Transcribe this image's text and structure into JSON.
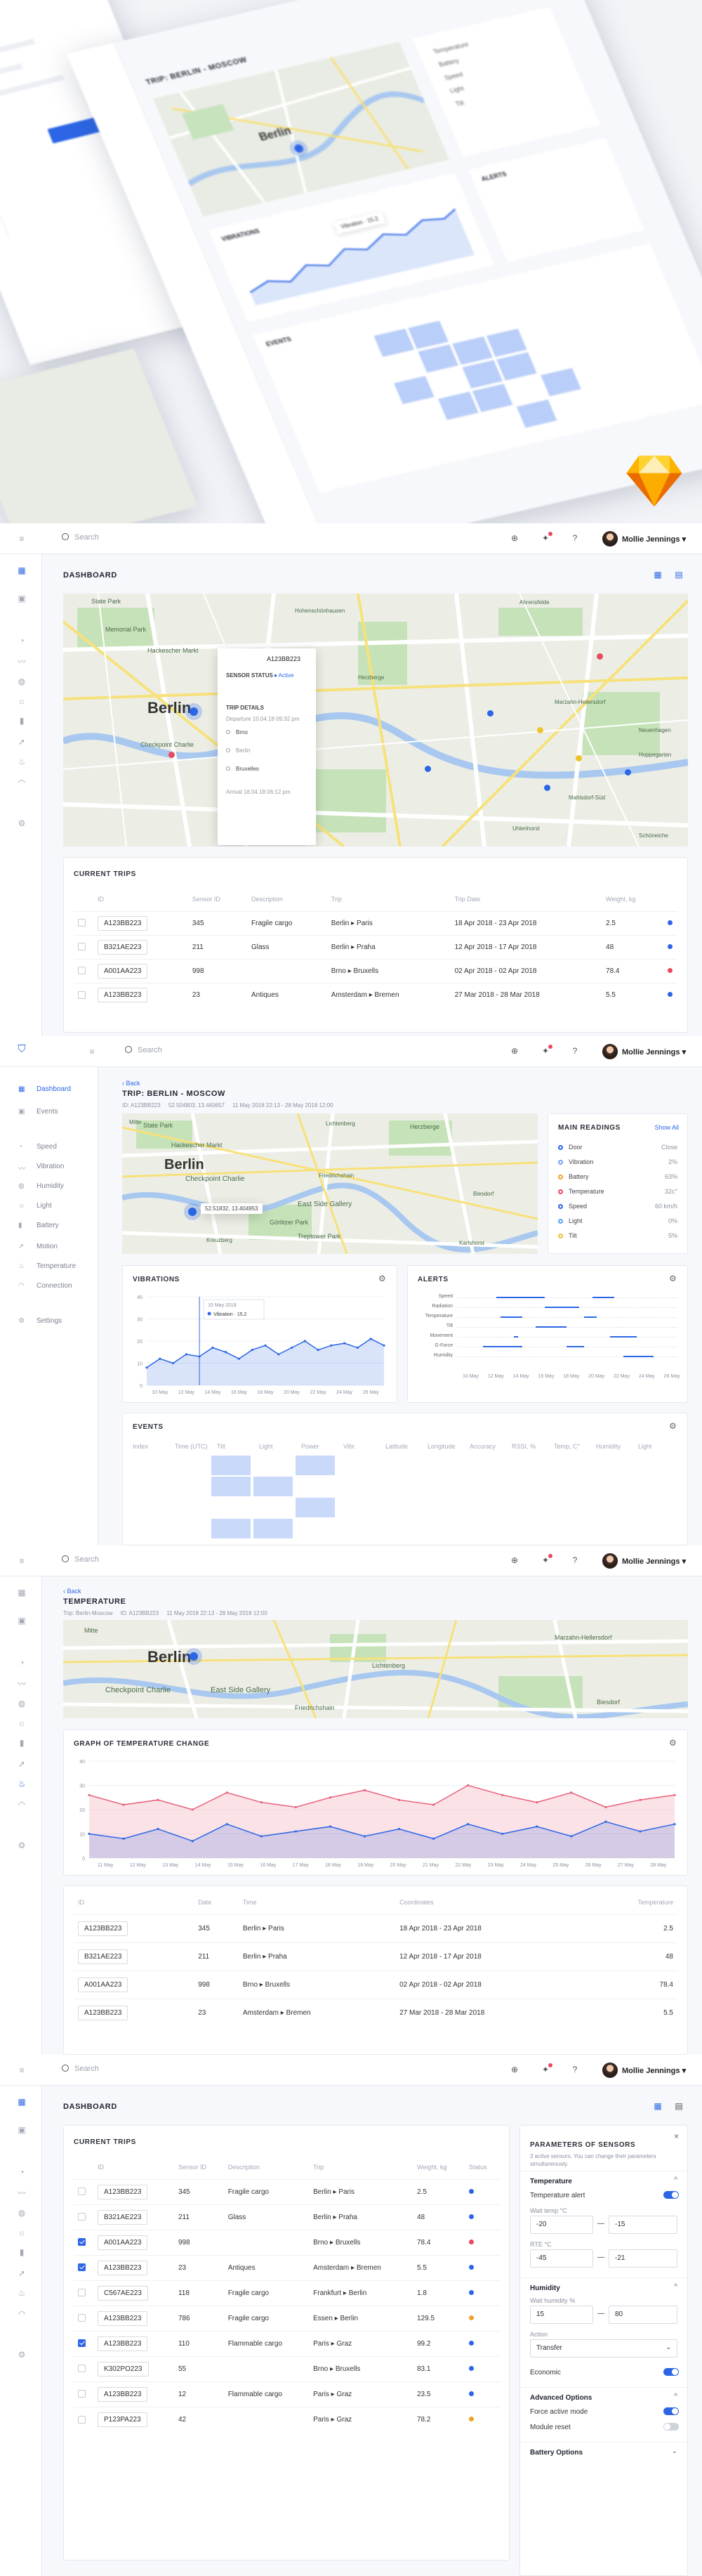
{
  "hero": {
    "trip_title": "TRIP: BERLIN - MOSCOW",
    "vibrations_label": "VIBRATIONS",
    "alerts_label": "ALERTS",
    "events_label": "EVENTS",
    "map_city": "Berlin",
    "vib_tooltip": "Vibration · 15.2",
    "left_menu": [
      "Temperature",
      "Battery",
      "Speed",
      "Light",
      "Tilt"
    ]
  },
  "chrome": {
    "search_placeholder": "Search",
    "user_name": "Mollie Jennings ▾"
  },
  "dashboard": {
    "title": "DASHBOARD",
    "map": {
      "city": "Berlin",
      "places": [
        "State Park",
        "Memorial Park",
        "Hackescher Markt",
        "Checkpoint Charlie",
        "Hohenschönhausen",
        "Herzberge",
        "Neuenhagen",
        "Hoppegarten",
        "Marzahn-Hellersdorf",
        "Mahlsdorf-Süd",
        "Ahrensfelde",
        "Uhlenhorst",
        "Schöneiche"
      ],
      "popup": {
        "id": "A123BB223",
        "status_label": "SENSOR STATUS",
        "status_value": "● Active",
        "details_label": "TRIP DETAILS",
        "departure": "Departure 10.04.18 09:32 pm",
        "from": "Brno",
        "via": "Berlin",
        "to": "Bruxelles",
        "arrival": "Arrival 18.04.18 06:12 pm"
      }
    },
    "trips": {
      "title": "CURRENT TRIPS",
      "columns": [
        "ID",
        "Sensor ID",
        "Description",
        "Trip",
        "Trip Date",
        "Weight, kg"
      ],
      "rows": [
        [
          "A123BB223",
          "345",
          "Fragile cargo",
          "Berlin ▸ Paris",
          "18 Apr 2018 - 23 Apr 2018",
          "2.5",
          "#2c66e6"
        ],
        [
          "B321AE223",
          "211",
          "Glass",
          "Berlin ▸ Praha",
          "12 Apr 2018 - 17 Apr 2018",
          "48",
          "#2c66e6"
        ],
        [
          "A001AA223",
          "998",
          "",
          "Brno ▸ Bruxells",
          "02 Apr 2018 - 02 Apr 2018",
          "78.4",
          "#e84a5f"
        ],
        [
          "A123BB223",
          "23",
          "Antiques",
          "Amsterdam ▸ Bremen",
          "27 Mar 2018 - 28 Mar 2018",
          "5.5",
          "#2c66e6"
        ]
      ]
    }
  },
  "trip_page": {
    "nav": [
      "Dashboard",
      "Events",
      "Speed",
      "Vibration",
      "Humidity",
      "Light",
      "Battery",
      "Motion",
      "Temperature",
      "Connection",
      "Settings"
    ],
    "back": "‹ Back",
    "title": "TRIP: BERLIN - MOSCOW",
    "meta": "ID: A123BB223     52.504803, 13.440657     11 May 2018 22:13 - 28 May 2018 12:00",
    "map_popup": "52.51832, 13.404953",
    "map_places": [
      "State Park",
      "Hackescher Markt",
      "Checkpoint Charlie",
      "East Side Gallery",
      "Görlitzer Park",
      "Treptower Park",
      "Herzberge",
      "Lichtenberg",
      "Friedrichshain",
      "Biesdorf",
      "Karlshorst",
      "Kreuzberg",
      "Mitte"
    ],
    "readings": {
      "title": "MAIN READINGS",
      "show_all": "Show All",
      "items": [
        {
          "name": "Door",
          "value": "Close",
          "color": "#2c66e6"
        },
        {
          "name": "Vibration",
          "value": "2%",
          "color": "#7aa2f2"
        },
        {
          "name": "Battery",
          "value": "63%",
          "color": "#f0a32a"
        },
        {
          "name": "Temperature",
          "value": "32c°",
          "color": "#e84a5f"
        },
        {
          "name": "Speed",
          "value": "60 km/h",
          "color": "#2c66e6"
        },
        {
          "name": "Light",
          "value": "0%",
          "color": "#5aa2ef"
        },
        {
          "name": "Tilt",
          "value": "5%",
          "color": "#f0c22a"
        }
      ]
    },
    "vibrations": {
      "title": "VIBRATIONS",
      "tooltip_date": "15 May 2018",
      "tooltip_value": "Vibration · 15.2"
    },
    "alerts": {
      "title": "ALERTS",
      "rows": [
        "Speed",
        "Radiation",
        "Temperature",
        "Tilt",
        "Movement",
        "G-Force",
        "Humidity"
      ]
    },
    "events": {
      "title": "EVENTS",
      "columns": [
        "Index",
        "Time (UTC)",
        "Tilt",
        "Light",
        "Power",
        "Vibr.",
        "Latitude",
        "Longitude",
        "Accuracy",
        "RSSI, %",
        "Temp, C°",
        "Humidity",
        "Light"
      ]
    }
  },
  "temperature": {
    "back": "‹ Back",
    "title": "TEMPERATURE",
    "meta": "Trip: Berlin-Moscow     ID: A123BB223     11 May 2018 22:13 - 28 May 2018 12:00",
    "map_places": [
      "Berlin",
      "Checkpoint Charlie",
      "East Side Gallery",
      "Friedrichshain",
      "Lichtenberg",
      "Marzahn-Hellersdorf",
      "Biesdorf",
      "Mitte"
    ],
    "chart_title": "GRAPH OF TEMPERATURE CHANGE",
    "table": {
      "columns": [
        "ID",
        "Date",
        "Time",
        "Coordinates",
        "Temperature"
      ],
      "rows": [
        [
          "A123BB223",
          "345",
          "Berlin ▸ Paris",
          "18 Apr 2018 - 23 Apr 2018",
          "2.5"
        ],
        [
          "B321AE223",
          "211",
          "Berlin ▸ Praha",
          "12 Apr 2018 - 17 Apr 2018",
          "48"
        ],
        [
          "A001AA223",
          "998",
          "Brno ▸ Bruxells",
          "02 Apr 2018 - 02 Apr 2018",
          "78.4"
        ],
        [
          "A123BB223",
          "23",
          "Amsterdam ▸ Bremen",
          "27 Mar 2018 - 28 Mar 2018",
          "5.5"
        ]
      ]
    }
  },
  "sensors_page": {
    "title": "DASHBOARD",
    "trips_title": "CURRENT TRIPS",
    "columns": [
      "ID",
      "Sensor ID",
      "Description",
      "Trip",
      "Weight, kg",
      "Status"
    ],
    "rows": [
      {
        "id": "A123BB223",
        "sensor": "345",
        "desc": "Fragile cargo",
        "trip": "Berlin ▸ Paris",
        "w": "2.5",
        "c": "#2c66e6",
        "chk": false
      },
      {
        "id": "B321AE223",
        "sensor": "211",
        "desc": "Glass",
        "trip": "Berlin ▸ Praha",
        "w": "48",
        "c": "#2c66e6",
        "chk": false
      },
      {
        "id": "A001AA223",
        "sensor": "998",
        "desc": "",
        "trip": "Brno ▸ Bruxells",
        "w": "78.4",
        "c": "#e84a5f",
        "chk": true
      },
      {
        "id": "A123BB223",
        "sensor": "23",
        "desc": "Antiques",
        "trip": "Amsterdam ▸ Bremen",
        "w": "5.5",
        "c": "#2c66e6",
        "chk": true
      },
      {
        "id": "C567AE223",
        "sensor": "118",
        "desc": "Fragile cargo",
        "trip": "Frankfurt ▸ Berlin",
        "w": "1.8",
        "c": "#2c66e6",
        "chk": false
      },
      {
        "id": "A123BB223",
        "sensor": "786",
        "desc": "Fragile cargo",
        "trip": "Essen ▸ Berlin",
        "w": "129.5",
        "c": "#f0a32a",
        "chk": false
      },
      {
        "id": "A123BB223",
        "sensor": "110",
        "desc": "Flammable cargo",
        "trip": "Paris ▸ Graz",
        "w": "99.2",
        "c": "#2c66e6",
        "chk": true
      },
      {
        "id": "K302PO223",
        "sensor": "55",
        "desc": "",
        "trip": "Brno ▸ Bruxells",
        "w": "83.1",
        "c": "#2c66e6",
        "chk": false
      },
      {
        "id": "A123BB223",
        "sensor": "12",
        "desc": "Flammable cargo",
        "trip": "Paris ▸ Graz",
        "w": "23.5",
        "c": "#2c66e6",
        "chk": false
      },
      {
        "id": "P123PA223",
        "sensor": "42",
        "desc": "",
        "trip": "Paris ▸ Graz",
        "w": "78.2",
        "c": "#f0a32a",
        "chk": false
      }
    ],
    "params": {
      "title": "PARAMETERS OF SENSORS",
      "subtitle": "3 active sensors. You can change their parameters simultaneously.",
      "temp_head": "Temperature",
      "temp_alert": "Temperature alert",
      "max_label": "Wait temp °C",
      "max_from": "-20",
      "max_to": "-15",
      "rt_label": "RTE °C",
      "rt_from": "-45",
      "rt_to": "-21",
      "hum_head": "Humidity",
      "hum_label": "Wait humidity %",
      "hum_from": "15",
      "hum_to": "80",
      "action_label": "Action",
      "action_value": "Transfer",
      "economic": "Economic",
      "adv_head": "Advanced Options",
      "force": "Force active mode",
      "reset": "Module reset",
      "battery": "Battery Options",
      "dash": "—"
    }
  },
  "chart_data": [
    {
      "type": "line",
      "title": "VIBRATIONS",
      "categories": [
        "10 May",
        "12 May",
        "14 May",
        "16 May",
        "18 May",
        "20 May",
        "22 May",
        "24 May",
        "26 May"
      ],
      "ylim": [
        0,
        40
      ],
      "yticks": [
        "0",
        "10",
        "20",
        "30",
        "40"
      ],
      "series": [
        {
          "name": "Vibration",
          "values": [
            8,
            12,
            10,
            14,
            13,
            17,
            15,
            12,
            16,
            18,
            14,
            17,
            20,
            16,
            18,
            19,
            17,
            21,
            18
          ]
        }
      ]
    },
    {
      "type": "line",
      "title": "GRAPH OF TEMPERATURE CHANGE",
      "categories": [
        "11 May",
        "12 May",
        "13 May",
        "14 May",
        "15 May",
        "16 May",
        "17 May",
        "18 May",
        "19 May",
        "20 May",
        "21 May",
        "22 May",
        "23 May",
        "24 May",
        "25 May",
        "26 May",
        "27 May",
        "28 May"
      ],
      "ylim": [
        0,
        40
      ],
      "yticks": [
        "0",
        "10",
        "20",
        "30",
        "40"
      ],
      "series": [
        {
          "values": [
            26,
            22,
            24,
            20,
            27,
            23,
            21,
            25,
            28,
            24,
            22,
            30,
            26,
            23,
            27,
            21,
            24,
            26
          ]
        },
        {
          "values": [
            10,
            8,
            12,
            7,
            14,
            9,
            11,
            13,
            9,
            12,
            8,
            14,
            10,
            13,
            9,
            15,
            11,
            14
          ]
        }
      ]
    }
  ]
}
